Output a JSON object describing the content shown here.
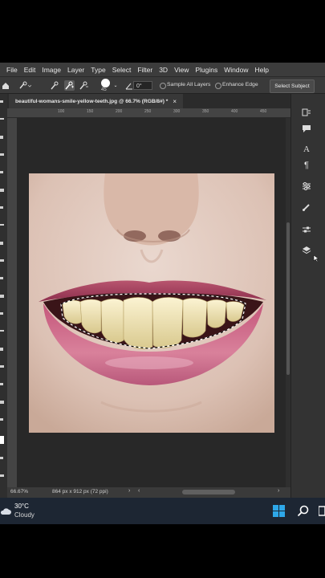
{
  "menu": [
    "File",
    "Edit",
    "Image",
    "Layer",
    "Type",
    "Select",
    "Filter",
    "3D",
    "View",
    "Plugins",
    "Window",
    "Help"
  ],
  "options": {
    "brush_size": "45",
    "angle": "0°",
    "sample_all_layers": "Sample All Layers",
    "enhance_edge": "Enhance Edge",
    "select_subject": "Select Subject"
  },
  "document": {
    "tab_title": "beautiful-womans-smile-yellow-teeth.jpg @ 66.7% (RGB/8#) *",
    "close": "×"
  },
  "ruler_top": [
    "100",
    "150",
    "200",
    "250",
    "300",
    "350",
    "400",
    "450",
    "500",
    "550",
    "600",
    "650",
    "700"
  ],
  "status": {
    "zoom": "66.67%",
    "doc_size": "864 px x 912 px (72 ppi)"
  },
  "taskbar": {
    "temperature": "30°C",
    "condition": "Cloudy"
  },
  "colors": {
    "accent": "#2ea7e8",
    "panel": "#3a3a3a",
    "canvas_bg": "#282828"
  }
}
